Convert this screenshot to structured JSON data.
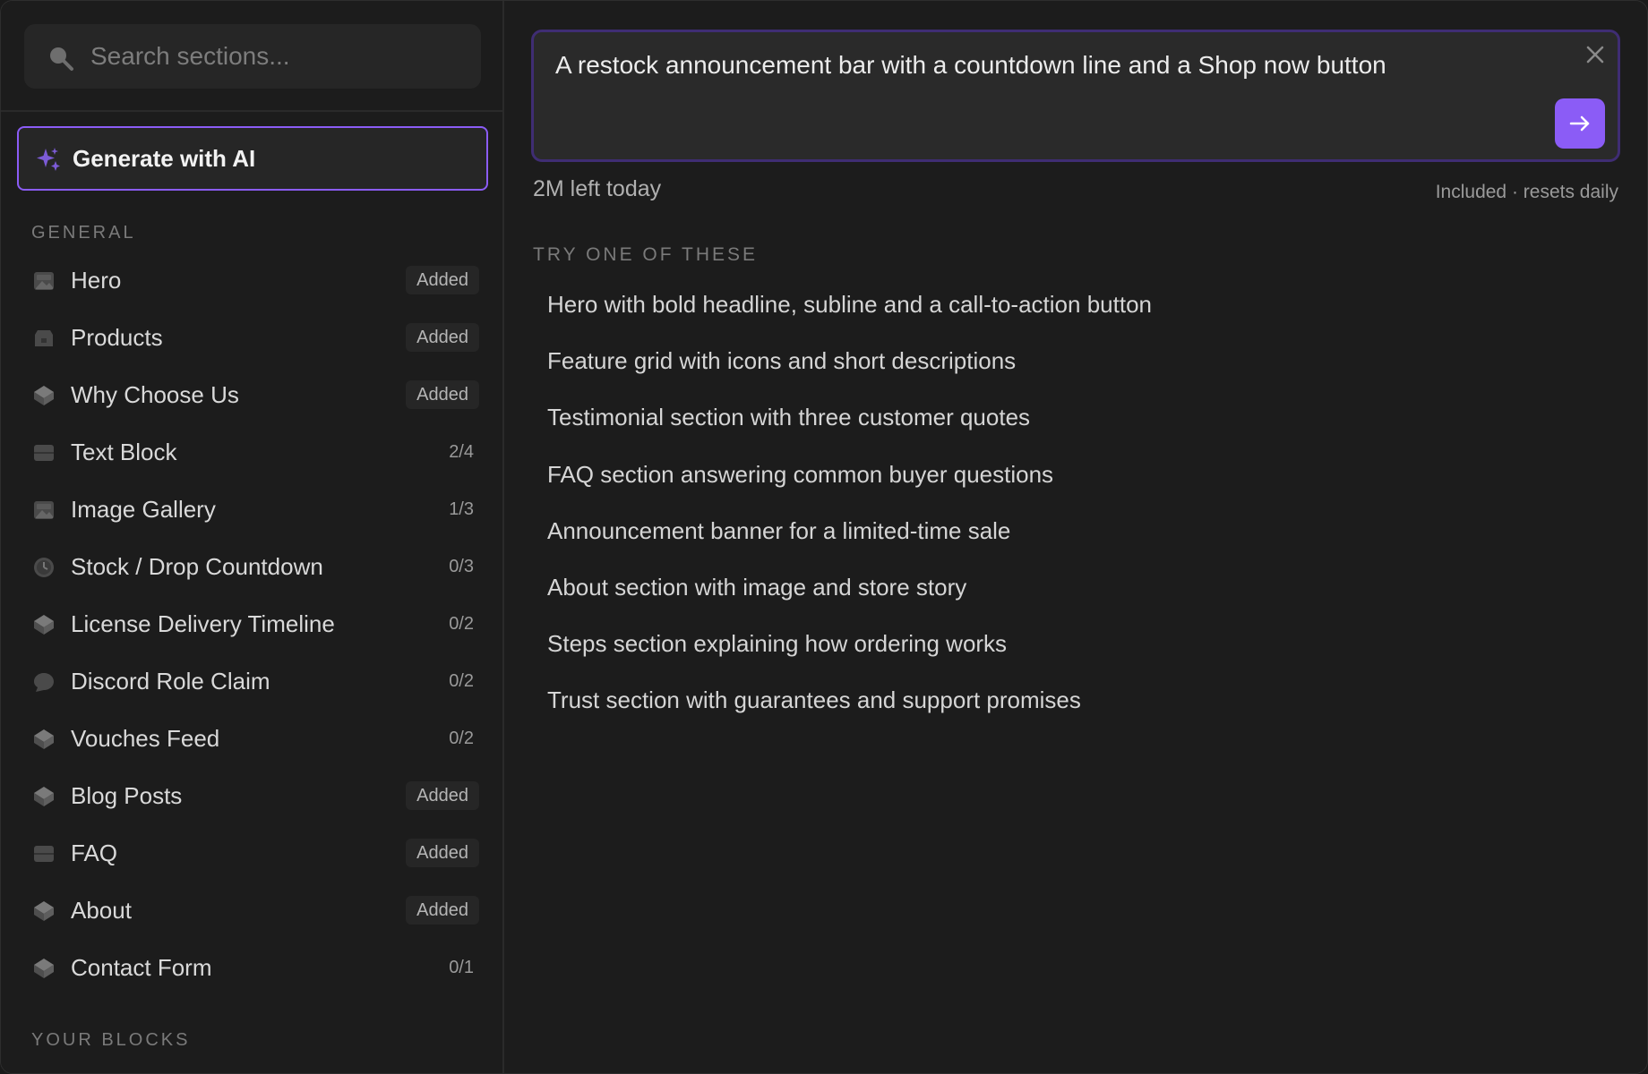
{
  "search": {
    "placeholder": "Search sections..."
  },
  "generate_ai": {
    "label": "Generate with AI"
  },
  "general_heading": "GENERAL",
  "sections": [
    {
      "name": "Hero",
      "status": "Added",
      "icon": "image-icon"
    },
    {
      "name": "Products",
      "status": "Added",
      "icon": "box-icon"
    },
    {
      "name": "Why Choose Us",
      "status": "Added",
      "icon": "cube-icon"
    },
    {
      "name": "Text Block",
      "status": "2/4",
      "icon": "text-block-icon"
    },
    {
      "name": "Image Gallery",
      "status": "1/3",
      "icon": "image-icon"
    },
    {
      "name": "Stock / Drop Countdown",
      "status": "0/3",
      "icon": "clock-icon"
    },
    {
      "name": "License Delivery Timeline",
      "status": "0/2",
      "icon": "cube-icon"
    },
    {
      "name": "Discord Role Claim",
      "status": "0/2",
      "icon": "chat-bubble-icon"
    },
    {
      "name": "Vouches Feed",
      "status": "0/2",
      "icon": "cube-icon"
    },
    {
      "name": "Blog Posts",
      "status": "Added",
      "icon": "cube-icon"
    },
    {
      "name": "FAQ",
      "status": "Added",
      "icon": "text-block-icon"
    },
    {
      "name": "About",
      "status": "Added",
      "icon": "cube-icon"
    },
    {
      "name": "Contact Form",
      "status": "0/1",
      "icon": "cube-icon"
    }
  ],
  "your_blocks_heading": "YOUR BLOCKS",
  "prompt": {
    "value": "A restock announcement bar with a countdown line and a Shop now button"
  },
  "quota": {
    "left": "2M left today",
    "note": "Included · resets daily"
  },
  "try_heading": "TRY ONE OF THESE",
  "suggestions": [
    "Hero with bold headline, subline and a call-to-action button",
    "Feature grid with icons and short descriptions",
    "Testimonial section with three customer quotes",
    "FAQ section answering common buyer questions",
    "Announcement banner for a limited-time sale",
    "About section with image and store story",
    "Steps section explaining how ordering works",
    "Trust section with guarantees and support promises"
  ],
  "colors": {
    "accent": "#8b5cf6",
    "background": "#1c1c1c",
    "panel": "#262626"
  }
}
